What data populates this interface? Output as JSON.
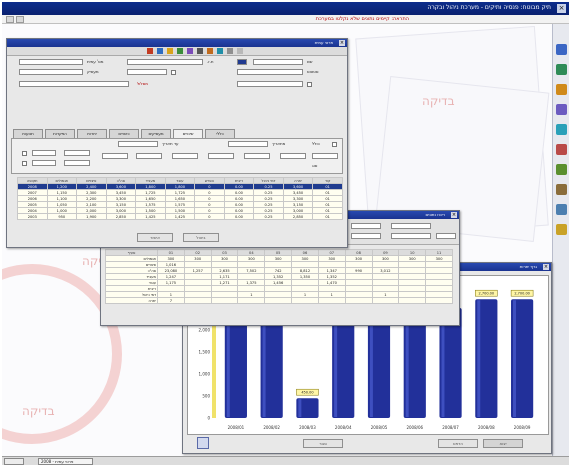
{
  "app": {
    "title": "תיק מבוטח: פנסיה ותיקים - מערכת ניהול ובקרה",
    "warning": "התראה: קיימים נתונים שלא נקלטו במערכת"
  },
  "watermark": {
    "text": "בדיקה"
  },
  "main_window": {
    "title": "פרטי עמית",
    "tabs": [
      "תנועות",
      "הפקדות",
      "יתרות",
      "כיסויים",
      "מעסיקים",
      "שינויים",
      "כללי"
    ],
    "labels": {
      "member": "מס' עמית",
      "id": "ת.ז.",
      "name": "שם",
      "employer": "מעסיק",
      "status": "סטטוס",
      "plan": "מסלול",
      "from_date": "מתאריך",
      "to_date": "עד תאריך",
      "include": "כולל",
      "type": "סוג"
    },
    "table": {
      "headers": [
        "תקופה",
        "תגמולים",
        "פיצויים",
        "סה\"כ",
        "מעביד",
        "עובד",
        "הפרש",
        "ריבית",
        "דמי ניהול",
        "יתרה",
        "קוד"
      ],
      "highlight_row": [
        "2008",
        "1,200",
        "2,400",
        "3,600",
        "1,800",
        "1,800",
        "0",
        "0.00",
        "0.25",
        "3,600",
        "01"
      ],
      "rows": [
        [
          "2007",
          "1,150",
          "2,300",
          "3,450",
          "1,725",
          "1,725",
          "0",
          "0.00",
          "0.25",
          "3,450",
          "01"
        ],
        [
          "2006",
          "1,100",
          "2,200",
          "3,300",
          "1,650",
          "1,650",
          "0",
          "0.00",
          "0.25",
          "3,300",
          "01"
        ],
        [
          "2005",
          "1,050",
          "2,100",
          "3,150",
          "1,575",
          "1,575",
          "0",
          "0.00",
          "0.25",
          "3,150",
          "01"
        ],
        [
          "2004",
          "1,000",
          "2,000",
          "3,000",
          "1,500",
          "1,500",
          "0",
          "0.00",
          "0.25",
          "3,000",
          "01"
        ],
        [
          "2003",
          "950",
          "1,900",
          "2,850",
          "1,425",
          "1,425",
          "0",
          "0.00",
          "0.25",
          "2,850",
          "01"
        ]
      ]
    },
    "buttons": {
      "ok": "אישור",
      "cancel": "ביטול"
    }
  },
  "mid_window": {
    "title": "ריכוז נתונים",
    "table": {
      "headers": [
        "סעיף",
        "01",
        "02",
        "03",
        "04",
        "05",
        "06",
        "07",
        "08",
        "09",
        "10",
        "11"
      ],
      "rows": [
        [
          "תגמולים",
          "300",
          "300",
          "300",
          "300",
          "300",
          "300",
          "300",
          "300",
          "300",
          "300",
          "300"
        ],
        [
          "פיצויים",
          "1,016",
          "",
          "",
          "",
          "",
          "",
          "",
          "",
          "",
          "",
          ""
        ],
        [
          "סה\"כ",
          "23,080",
          "1,257",
          "2,635",
          "7,502",
          "742",
          "8,812",
          "1,347",
          "990",
          "3,012",
          "",
          ""
        ],
        [
          "מעביד",
          "1,247",
          "",
          "1,171",
          "",
          "1,352",
          "1,350",
          "1,352",
          "",
          "",
          "",
          ""
        ],
        [
          "עובד",
          "1,175",
          "",
          "1,271",
          "1,375",
          "1,456",
          "",
          "1,470",
          "",
          "",
          "",
          ""
        ],
        [
          "ריבית",
          "",
          "",
          "",
          "",
          "",
          "",
          "",
          "",
          "",
          "",
          ""
        ],
        [
          "דמי ניהול",
          "1",
          "",
          "",
          "1",
          "",
          "1",
          "1",
          "",
          "1",
          "",
          ""
        ],
        [
          "יתרה",
          "7",
          "",
          "",
          "",
          "",
          "",
          "",
          "",
          "",
          "",
          ""
        ]
      ]
    }
  },
  "chart_window": {
    "title": "גרף יתרות",
    "buttons": [
      "סגור",
      "הדפס",
      "יצוא"
    ],
    "icon": "chart-icon"
  },
  "chart_data": {
    "type": "bar",
    "categories": [
      "2008/01",
      "2008/02",
      "2008/03",
      "2008/04",
      "2008/05",
      "2008/06",
      "2008/07",
      "2008/08",
      "2008/09"
    ],
    "values": [
      2500,
      2500,
      450,
      2500,
      2500,
      2500,
      2500,
      2700,
      2700
    ],
    "ylim": [
      0,
      3000
    ],
    "y_ticks": [
      "3,000",
      "2,500",
      "2,000",
      "1,500",
      "1,000",
      "500",
      "0"
    ],
    "bar_labels": [
      "",
      "",
      "450.00",
      "",
      "",
      "",
      "",
      "2,700.00",
      "2,700.00"
    ],
    "colors": {
      "bar": "#22309a",
      "bar_highlight": "#4a5cd0",
      "label_box": "#fff6a6",
      "axis_strip": "#f0e26a"
    },
    "grid": false
  },
  "taskbar": {
    "task_label": "פרטי עמית - 2008"
  }
}
